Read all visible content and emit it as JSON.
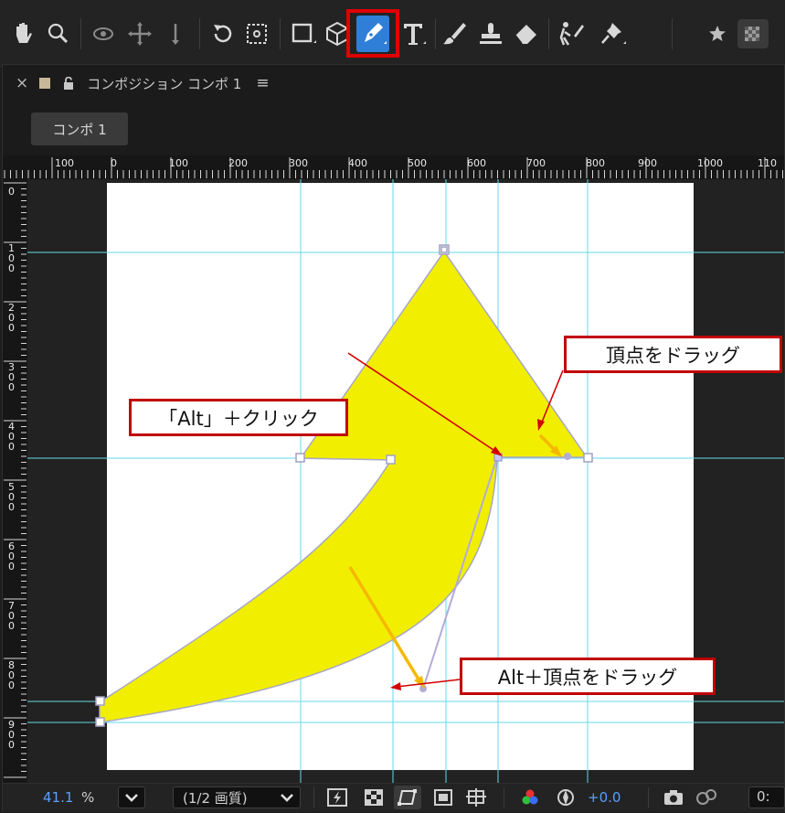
{
  "toolbar": {
    "tools": [
      "hand-tool",
      "zoom-tool",
      "orbit-camera-tool",
      "pan-camera-tool",
      "dolly-camera-tool",
      "rotation-tool",
      "anchor-point-tool",
      "rectangle-tool",
      "3d-box-tool",
      "pen-tool",
      "type-tool",
      "brush-tool",
      "clone-stamp-tool",
      "eraser-tool",
      "roto-brush-tool",
      "puppet-pin-tool"
    ],
    "active_tool": "pen-tool"
  },
  "panel": {
    "close_glyph": "×",
    "lock_glyph": "🔓",
    "title": "コンポジション コンポ 1",
    "menu_glyph": "≡",
    "comp_button": "コンポ 1"
  },
  "rulers": {
    "h_labels": [
      "100",
      "0",
      "100",
      "200",
      "300",
      "400",
      "500",
      "600",
      "700",
      "800",
      "900",
      "1000",
      "110"
    ],
    "v_labels": [
      "0",
      "1\n0\n0",
      "2\n0\n0",
      "3\n0\n0",
      "4\n0\n0",
      "5\n0\n0",
      "6\n0\n0",
      "7\n0\n0",
      "8\n0\n0",
      "9\n0\n0"
    ]
  },
  "callouts": {
    "drag_vertex": "頂点をドラッグ",
    "alt_click": "「Alt」＋クリック",
    "alt_drag_vertex": "Alt＋頂点をドラッグ"
  },
  "footer": {
    "zoom": "41.1",
    "zoom_unit": "%",
    "resolution": "(1/2 画質)",
    "exposure": "+0.0",
    "timecode": "0:"
  },
  "colors": {
    "accent": "#2f7fd8",
    "highlight": "#e00000",
    "shape_fill": "#f2ee00",
    "guide": "#66d9e8",
    "arrow_red": "#d40000",
    "arrow_orange": "#f5b800"
  }
}
